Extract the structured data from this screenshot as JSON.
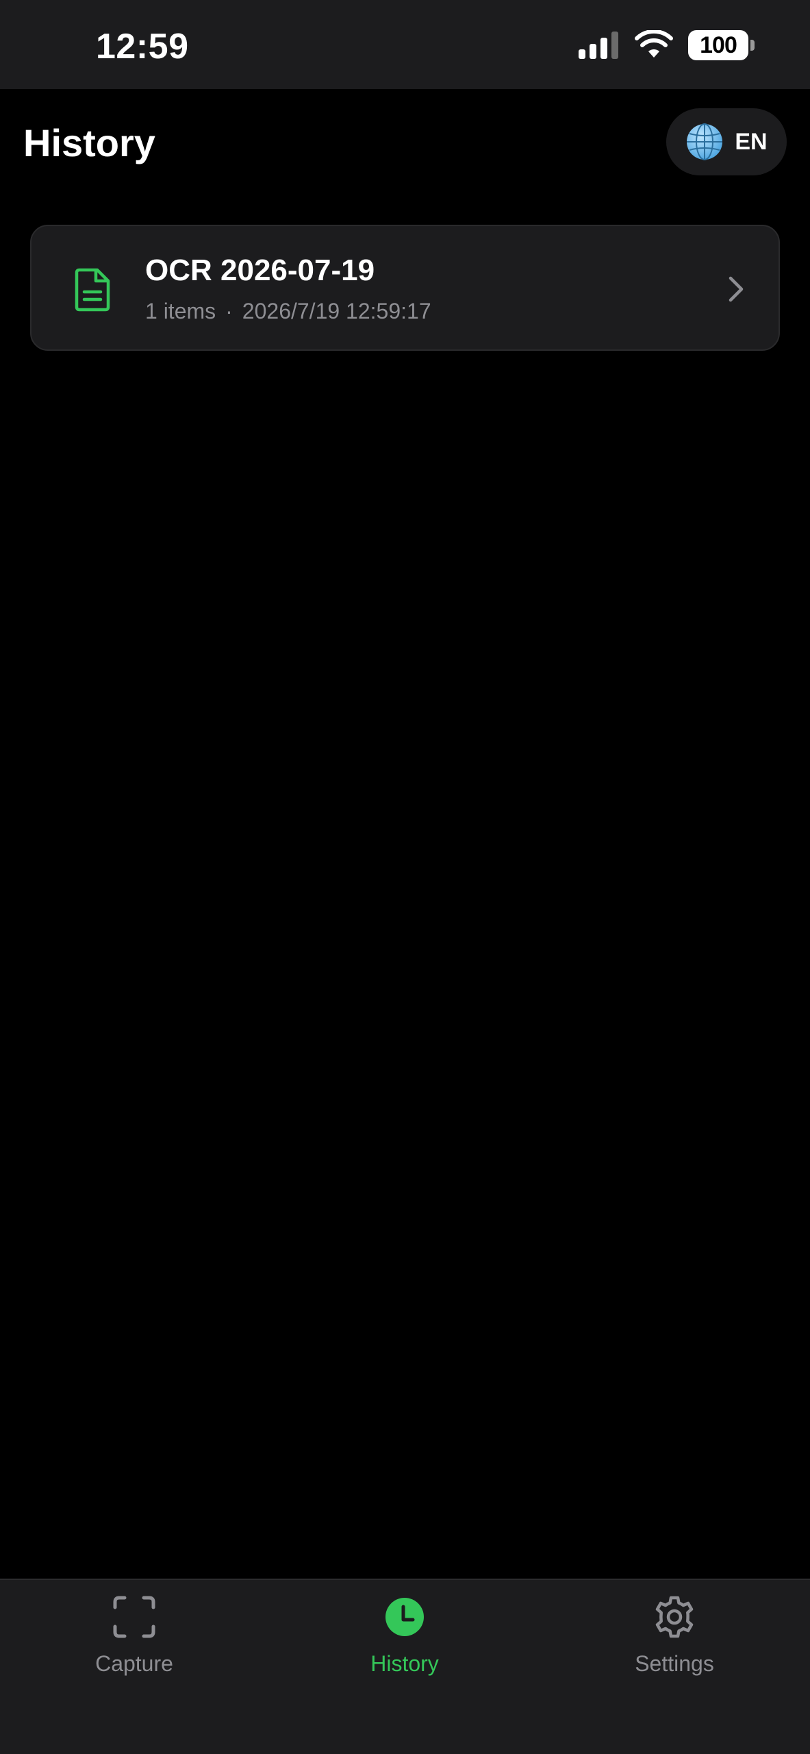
{
  "status_bar": {
    "time": "12:59",
    "battery": "100",
    "icons": [
      "signal-icon",
      "wifi-icon",
      "battery-icon"
    ]
  },
  "header": {
    "title": "History",
    "language_button": {
      "icon": "globe-icon",
      "label": "EN"
    }
  },
  "history": {
    "items": [
      {
        "icon": "document-icon",
        "title": "OCR 2026-07-19",
        "count": "1 items",
        "separator": "·",
        "timestamp": "2026/7/19 12:59:17"
      }
    ]
  },
  "tab_bar": {
    "tabs": [
      {
        "label": "Capture",
        "icon": "scan-frame-icon",
        "active": false
      },
      {
        "label": "History",
        "icon": "clock-icon",
        "active": true
      },
      {
        "label": "Settings",
        "icon": "gear-icon",
        "active": false
      }
    ]
  },
  "colors": {
    "background": "#000000",
    "surface": "#1c1c1e",
    "accent": "#34c759",
    "secondary_text": "#8e8e93",
    "primary_text": "#ffffff"
  }
}
